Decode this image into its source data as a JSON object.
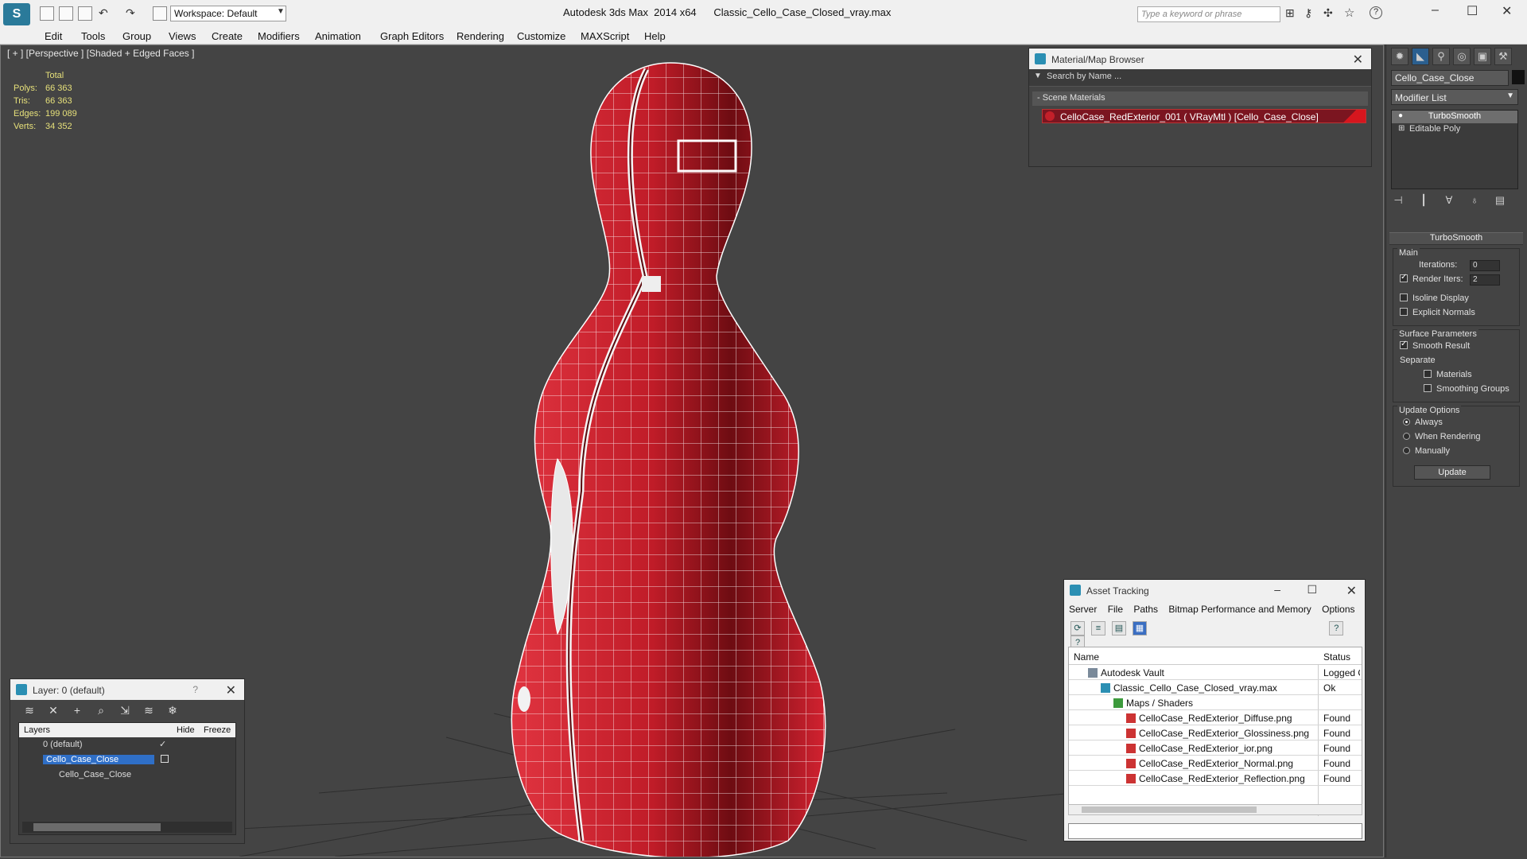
{
  "titlebar": {
    "app": "Autodesk 3ds Max  2014 x64",
    "file": "Classic_Cello_Case_Closed_vray.max",
    "workspace": "Workspace: Default",
    "search_placeholder": "Type a keyword or phrase"
  },
  "menu": [
    "Edit",
    "Tools",
    "Group",
    "Views",
    "Create",
    "Modifiers",
    "Animation",
    "Graph Editors",
    "Rendering",
    "Customize",
    "MAXScript",
    "Help"
  ],
  "viewport": {
    "label": "[ + ] [Perspective ] [Shaded + Edged Faces ]",
    "stats": {
      "header": "Total",
      "rows": [
        {
          "k": "Polys:",
          "v": "66 363"
        },
        {
          "k": "Tris:",
          "v": "66 363"
        },
        {
          "k": "Edges:",
          "v": "199 089"
        },
        {
          "k": "Verts:",
          "v": "34 352"
        }
      ]
    },
    "colors": {
      "background": "#444444",
      "model": "#b8141f",
      "wire": "#ffffff"
    }
  },
  "material_browser": {
    "title": "Material/Map Browser",
    "search_placeholder": "Search by Name ...",
    "section": "Scene Materials",
    "material": "CelloCase_RedExterior_001  ( VRayMtl )  [Cello_Case_Close]"
  },
  "command_panel": {
    "object_name": "Cello_Case_Close",
    "modifier_list": "Modifier List",
    "stack": [
      "TurboSmooth",
      "Editable Poly"
    ],
    "rollout_title": "TurboSmooth",
    "main_label": "Main",
    "iterations_label": "Iterations:",
    "iterations_value": "0",
    "render_iters_label": "Render Iters:",
    "render_iters_value": "2",
    "isoline": "Isoline Display",
    "explicit_normals": "Explicit Normals",
    "surface_params": "Surface Parameters",
    "smooth_result": "Smooth Result",
    "separate": "Separate",
    "materials": "Materials",
    "smoothing_groups": "Smoothing Groups",
    "update_options": "Update Options",
    "always": "Always",
    "when_rendering": "When Rendering",
    "manually": "Manually",
    "update_button": "Update"
  },
  "layer_panel": {
    "title": "Layer: 0 (default)",
    "help": "?",
    "col_layers": "Layers",
    "col_hide": "Hide",
    "col_freeze": "Freeze",
    "rows": [
      "0 (default)",
      "Cello_Case_Close",
      "Cello_Case_Close"
    ]
  },
  "asset_tracking": {
    "title": "Asset Tracking",
    "menu": [
      "Server",
      "File",
      "Paths",
      "Bitmap Performance and Memory",
      "Options"
    ],
    "col_name": "Name",
    "col_status": "Status",
    "rows": [
      {
        "name": "Autodesk Vault",
        "status": "Logged O"
      },
      {
        "name": "Classic_Cello_Case_Closed_vray.max",
        "status": "Ok"
      },
      {
        "name": "Maps / Shaders",
        "status": ""
      },
      {
        "name": "CelloCase_RedExterior_Diffuse.png",
        "status": "Found"
      },
      {
        "name": "CelloCase_RedExterior_Glossiness.png",
        "status": "Found"
      },
      {
        "name": "CelloCase_RedExterior_ior.png",
        "status": "Found"
      },
      {
        "name": "CelloCase_RedExterior_Normal.png",
        "status": "Found"
      },
      {
        "name": "CelloCase_RedExterior_Reflection.png",
        "status": "Found"
      }
    ]
  }
}
